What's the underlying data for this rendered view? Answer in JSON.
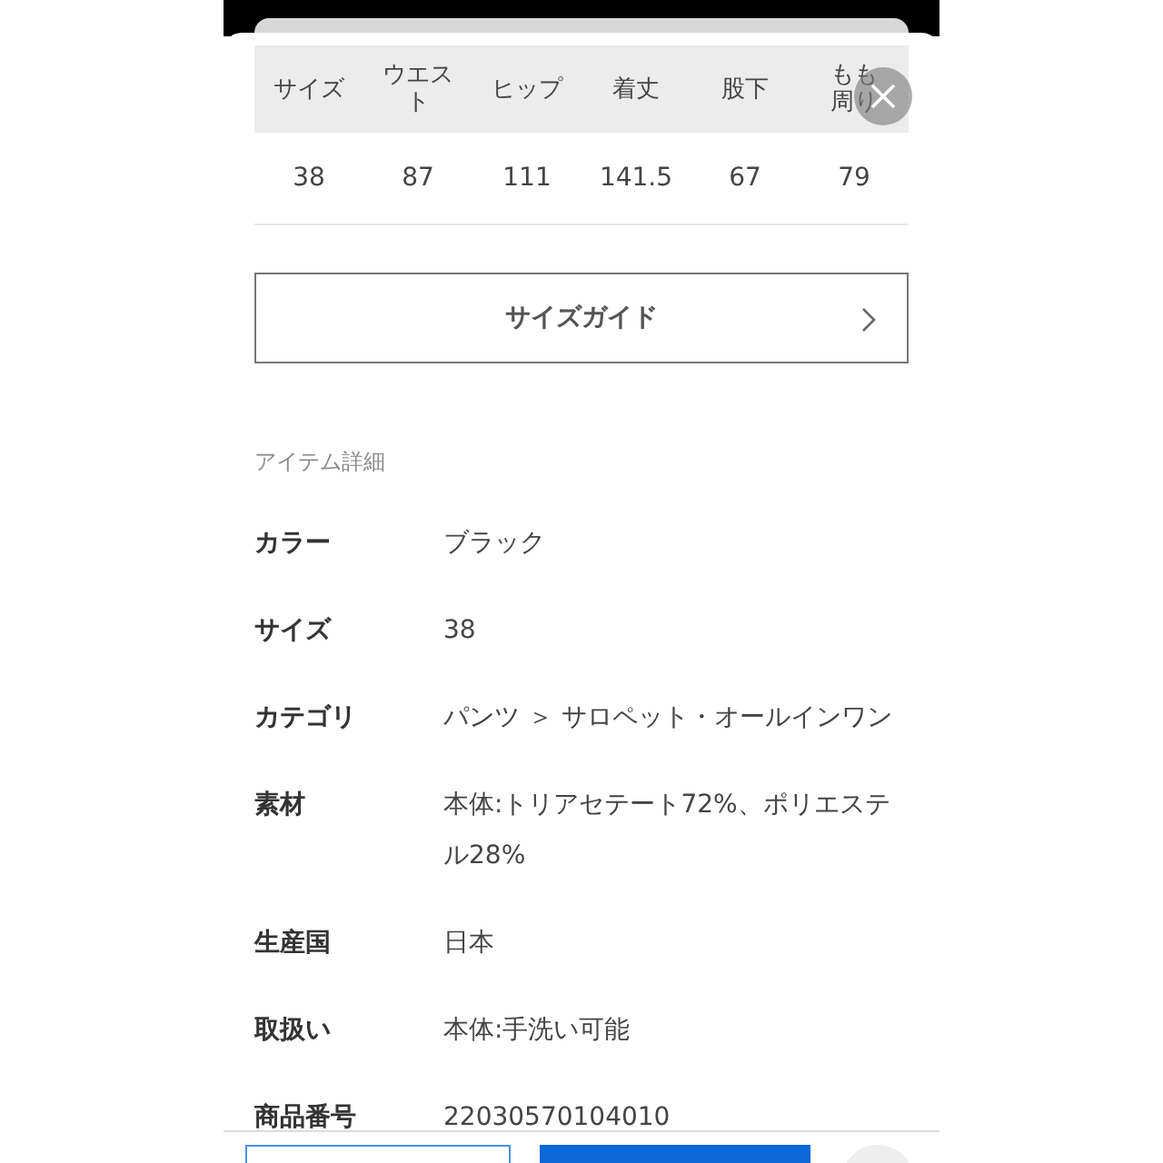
{
  "size_table": {
    "columns": [
      "サイズ",
      "ウエスト",
      "ヒップ",
      "着丈",
      "股下",
      "もも周り"
    ],
    "rows": [
      [
        "38",
        "87",
        "111",
        "141.5",
        "67",
        "79"
      ]
    ]
  },
  "size_guide_button": {
    "label": "サイズガイド"
  },
  "section_title": "アイテム詳細",
  "details": [
    {
      "label": "カラー",
      "value": "ブラック"
    },
    {
      "label": "サイズ",
      "value": "38"
    },
    {
      "label": "カテゴリ",
      "value": "パンツ ＞ サロペット・オールインワン"
    },
    {
      "label": "素材",
      "value": "本体:トリアセテート72%、ポリエステル28%"
    },
    {
      "label": "生産国",
      "value": "日本"
    },
    {
      "label": "取扱い",
      "value": "本体:手洗い可能"
    },
    {
      "label": "商品番号",
      "value": "22030570104010"
    }
  ]
}
